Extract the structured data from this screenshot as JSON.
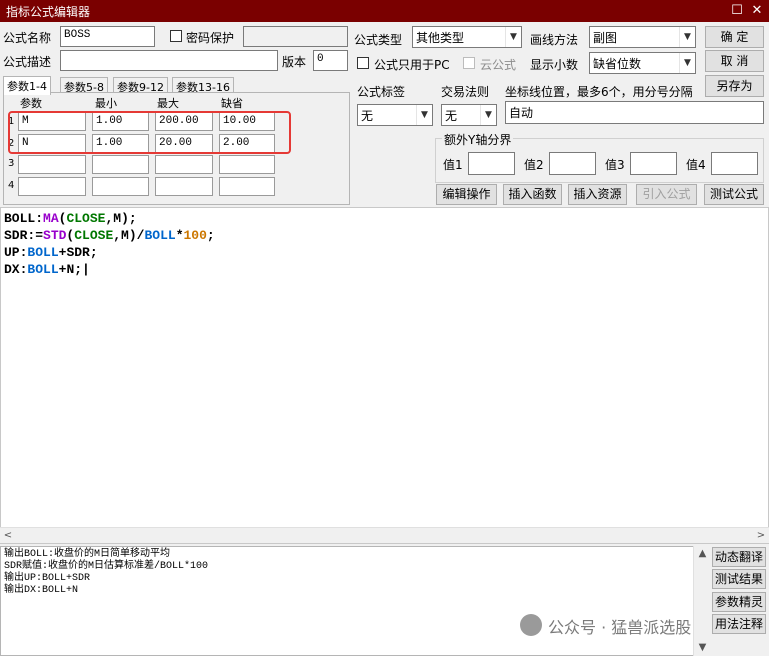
{
  "window": {
    "title": "指标公式编辑器",
    "maximize_glyph": "☐",
    "close_glyph": "✕"
  },
  "form": {
    "name_label": "公式名称",
    "name_value": "BOSS",
    "password_label": "密码保护",
    "desc_label": "公式描述",
    "version_label": "版本",
    "version_value": "0",
    "type_label": "公式类型",
    "type_value": "其他类型",
    "draw_label": "画线方法",
    "draw_value": "副图",
    "pc_only_label": "公式只用于PC",
    "cloud_label": "云公式",
    "decimals_label": "显示小数",
    "decimals_value": "缺省位数",
    "tag_label": "公式标签",
    "tag_value": "无",
    "trade_label": "交易法则",
    "trade_value": "无",
    "coord_label": "坐标线位置，最多6个，用分号分隔",
    "coord_value": "自动",
    "extra_y_label": "额外Y轴分界",
    "values": [
      "值1",
      "值2",
      "值3",
      "值4"
    ]
  },
  "buttons": {
    "ok": "确 定",
    "cancel": "取 消",
    "save_as": "另存为",
    "edit_op": "编辑操作",
    "insert_fn": "插入函数",
    "insert_res": "插入资源",
    "import_formula": "引入公式",
    "test_formula": "测试公式"
  },
  "tabs": [
    "参数1-4",
    "参数5-8",
    "参数9-12",
    "参数13-16"
  ],
  "params": {
    "headers": [
      "参数",
      "最小",
      "最大",
      "缺省"
    ],
    "rows": [
      {
        "num": "1",
        "name": "M",
        "min": "1.00",
        "max": "200.00",
        "def": "10.00"
      },
      {
        "num": "2",
        "name": "N",
        "min": "1.00",
        "max": "20.00",
        "def": "2.00"
      },
      {
        "num": "3",
        "name": "",
        "min": "",
        "max": "",
        "def": ""
      },
      {
        "num": "4",
        "name": "",
        "min": "",
        "max": "",
        "def": ""
      }
    ]
  },
  "code": {
    "l1": [
      "BOLL",
      ":",
      "MA",
      "(",
      "CLOSE",
      ",M);"
    ],
    "l2": [
      "SDR",
      ":=",
      "STD",
      "(",
      "CLOSE",
      ",M)/",
      "BOLL",
      "*",
      "100",
      ";"
    ],
    "l3": [
      "UP",
      ":",
      "BOLL",
      "+SDR;"
    ],
    "l4": [
      "DX",
      ":",
      "BOLL",
      "+N;"
    ]
  },
  "output_lines": [
    "输出BOLL:收盘价的M日简单移动平均",
    "SDR赋值:收盘价的M日估算标准差/BOLL*100",
    "输出UP:BOLL+SDR",
    "输出DX:BOLL+N"
  ],
  "side_buttons": [
    "动态翻译",
    "测试结果",
    "参数精灵",
    "用法注释"
  ],
  "watermark": "公众号 · 猛兽派选股",
  "colors": {
    "titlebar": "#7a0000",
    "highlight": "#e53935",
    "code_ref": "#0066cc",
    "code_fn": "#9900cc",
    "code_const": "#007700",
    "code_num": "#cc7700"
  }
}
